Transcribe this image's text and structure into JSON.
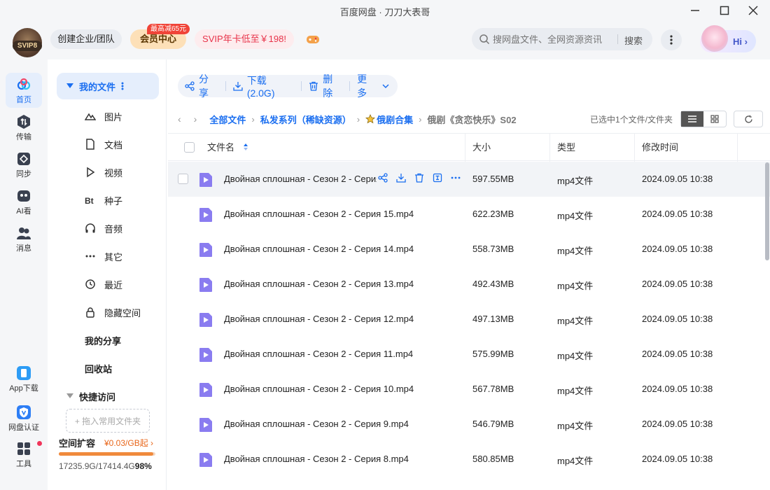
{
  "window": {
    "title": "百度网盘 · 刀刀大表哥"
  },
  "header": {
    "svip_tag": "SVIP8",
    "enterprise_label": "创建企业/团队",
    "vip_center_label": "会员中心",
    "vip_badge": "最高减65元",
    "promo_label": "SVIP年卡低至￥198!",
    "search_placeholder": "搜网盘文件、全网资源资讯",
    "search_button": "搜索",
    "greeting": "Hi"
  },
  "rail": [
    {
      "label": "首页",
      "icon": "cloud-icon",
      "active": true
    },
    {
      "label": "传输",
      "icon": "transfer-icon"
    },
    {
      "label": "同步",
      "icon": "sync-icon"
    },
    {
      "label": "AI看",
      "icon": "ai-watch-icon"
    },
    {
      "label": "消息",
      "icon": "messages-icon"
    },
    {
      "label": "App下载",
      "icon": "app-download-icon"
    },
    {
      "label": "网盘认证",
      "icon": "verified-icon"
    },
    {
      "label": "工具",
      "icon": "tools-icon"
    }
  ],
  "sidebar": {
    "my_files": "我的文件",
    "items": [
      {
        "label": "图片",
        "icon": "image-icon"
      },
      {
        "label": "文档",
        "icon": "document-icon"
      },
      {
        "label": "视频",
        "icon": "video-icon"
      },
      {
        "label": "种子",
        "icon": "torrent-icon",
        "glyph": "Bt"
      },
      {
        "label": "音频",
        "icon": "audio-icon"
      },
      {
        "label": "其它",
        "icon": "other-icon"
      },
      {
        "label": "最近",
        "icon": "recent-icon"
      },
      {
        "label": "隐藏空间",
        "icon": "lock-icon"
      }
    ],
    "my_share": "我的分享",
    "recycle": "回收站",
    "quick_access": "快捷访问",
    "quick_drop": "+ 拖入常用文件夹",
    "space_title": "空间扩容",
    "space_price": "¥0.03/GB起",
    "space_usage": "17235.9G/17414.4G",
    "space_percent": "98%",
    "space_fraction": 0.98
  },
  "toolbar": {
    "share": "分享",
    "download": "下载(2.0G)",
    "delete": "删除",
    "more": "更多"
  },
  "breadcrumb": {
    "items": [
      "全部文件",
      "私发系列（稀缺资源）",
      "俄剧合集"
    ],
    "current": "俄剧《贪恋快乐》S02",
    "selected_info": "已选中1个文件/文件夹"
  },
  "table": {
    "columns": {
      "name": "文件名",
      "size": "大小",
      "type": "类型",
      "mtime": "修改时间"
    },
    "rows": [
      {
        "name": "Двойная сплошная - Сезон 2 - Серия 16.mp4",
        "size": "597.55MB",
        "type": "mp4文件",
        "mtime": "2024.09.05 10:38",
        "hover": true
      },
      {
        "name": "Двойная сплошная - Сезон 2 - Серия 15.mp4",
        "size": "622.23MB",
        "type": "mp4文件",
        "mtime": "2024.09.05 10:38"
      },
      {
        "name": "Двойная сплошная - Сезон 2 - Серия 14.mp4",
        "size": "558.73MB",
        "type": "mp4文件",
        "mtime": "2024.09.05 10:38"
      },
      {
        "name": "Двойная сплошная - Сезон 2 - Серия 13.mp4",
        "size": "492.43MB",
        "type": "mp4文件",
        "mtime": "2024.09.05 10:38"
      },
      {
        "name": "Двойная сплошная - Сезон 2 - Серия 12.mp4",
        "size": "497.13MB",
        "type": "mp4文件",
        "mtime": "2024.09.05 10:38"
      },
      {
        "name": "Двойная сплошная - Сезон 2 - Серия 11.mp4",
        "size": "575.99MB",
        "type": "mp4文件",
        "mtime": "2024.09.05 10:38"
      },
      {
        "name": "Двойная сплошная - Сезон 2 - Серия 10.mp4",
        "size": "567.78MB",
        "type": "mp4文件",
        "mtime": "2024.09.05 10:38"
      },
      {
        "name": "Двойная сплошная - Сезон 2 - Серия 9.mp4",
        "size": "546.79MB",
        "type": "mp4文件",
        "mtime": "2024.09.05 10:38"
      },
      {
        "name": "Двойная сплошная - Сезон 2 - Серия 8.mp4",
        "size": "580.85MB",
        "type": "mp4文件",
        "mtime": "2024.09.05 10:38"
      }
    ]
  },
  "colors": {
    "accent": "#1a6ef0",
    "video_icon": "#8a7cf0",
    "promo": "#e8334a",
    "space": "#f08a3c"
  }
}
